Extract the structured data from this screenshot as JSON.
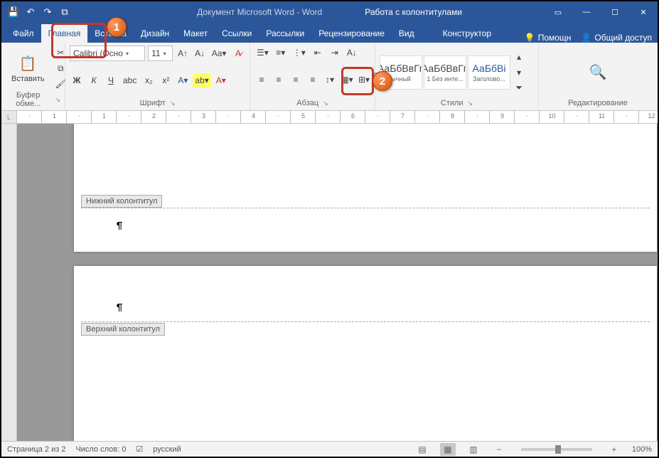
{
  "titlebar": {
    "doc_title": "Документ Microsoft Word - Word",
    "contextual": "Работа с колонтитулами"
  },
  "tabs": {
    "file": "Файл",
    "home": "Главная",
    "insert": "Вставка",
    "design": "Дизайн",
    "layout": "Макет",
    "references": "Ссылки",
    "mailings": "Рассылки",
    "review": "Рецензирование",
    "view": "Вид",
    "constructor": "Конструктор",
    "tell_me": "Помощн",
    "share": "Общий доступ"
  },
  "ribbon": {
    "clipboard": {
      "paste": "Вставить",
      "label": "Буфер обме..."
    },
    "font": {
      "name": "Calibri (Осно",
      "size": "11",
      "label": "Шрифт",
      "bold": "Ж",
      "italic": "К",
      "underline": "Ч"
    },
    "paragraph": {
      "label": "Абзац",
      "pilcrow": "¶"
    },
    "styles": {
      "label": "Стили",
      "preview": "АаБбВвГг,",
      "preview_hl": "АаБбВі",
      "s1": "ычный",
      "s2": "1 Без инте...",
      "s3": "Заголово..."
    },
    "editing": {
      "label": "Редактирование"
    }
  },
  "document": {
    "footer_label": "Нижний колонтитул",
    "header_label": "Верхний колонтитул",
    "pilcrow": "¶"
  },
  "statusbar": {
    "page": "Страница 2 из 2",
    "words": "Число слов: 0",
    "lang": "русский",
    "zoom": "100%"
  },
  "callouts": {
    "one": "1",
    "two": "2"
  }
}
